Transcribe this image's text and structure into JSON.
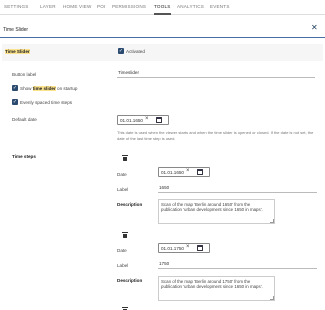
{
  "tabs": [
    "SETTINGS",
    "LAYER",
    "HOME VIEW",
    "POI",
    "PERMISSIONS",
    "TOOLS",
    "ANALYTICS",
    "EVENTS"
  ],
  "active_tab": "TOOLS",
  "search": {
    "value": "Time Slider"
  },
  "tool": {
    "name": "Time Slider",
    "activated_label": "Activated",
    "activated": true
  },
  "button_label": {
    "label": "Button label",
    "value": "Timeslider"
  },
  "show_on_startup": {
    "label_pre": "Show ",
    "label_mark": "time slider",
    "label_post": " on startup",
    "checked": true
  },
  "evenly_spaced": {
    "label": "Evenly spaced time steps",
    "checked": true
  },
  "default_date": {
    "label": "Default date",
    "value": "01.01.1650",
    "help": "This date is used when the viewer starts and when the time slider is opened or closed. If the date is not set, the date of the last time step is used."
  },
  "time_steps": {
    "label": "Time steps",
    "date_label": "Date",
    "label_label": "Label",
    "description_label": "Description",
    "items": [
      {
        "date": "01.01.1650",
        "label": "1650",
        "description": "Scan of the map 'Berlin around 1650' from the publication 'urban development since 1650 in maps'."
      },
      {
        "date": "01.01.1750",
        "label": "1750",
        "description": "Scan of the map 'Berlin around 1750' from the publication 'urban development since 1650 in maps'."
      }
    ]
  },
  "colors": {
    "accent": "#2b4a6f",
    "highlight": "#fbe28d"
  },
  "icons": {
    "close": "close-icon",
    "trash": "trash-icon",
    "calendar": "calendar-icon",
    "clear": "clear-x-icon"
  }
}
